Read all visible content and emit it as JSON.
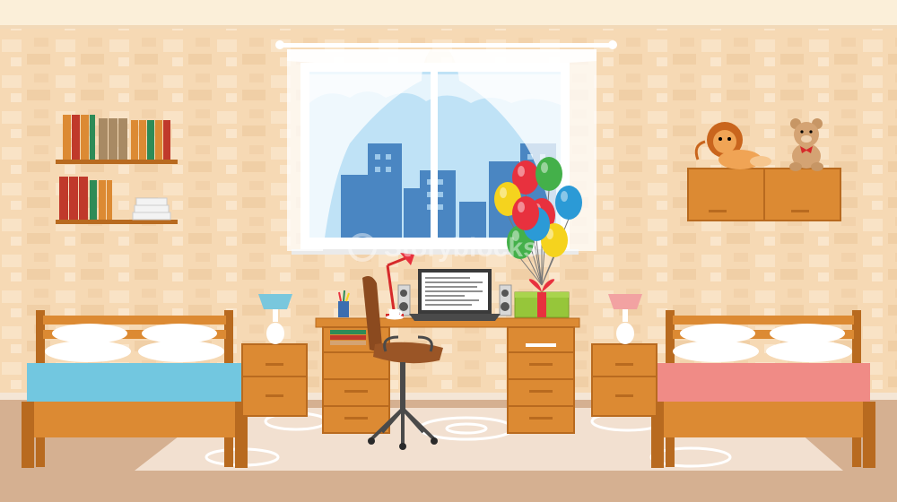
{
  "scene": {
    "title": "",
    "objects": [
      "wallpaper",
      "ceiling-molding",
      "window",
      "curtains",
      "cityscape",
      "bookshelf-upper",
      "bookshelf-lower",
      "wall-cabinet",
      "toy-lion",
      "teddy-bear",
      "bed-left-blue",
      "bed-right-pink",
      "nightstand-left",
      "nightstand-right",
      "lamp-blue",
      "lamp-pink",
      "desk",
      "desk-lamp",
      "laptop",
      "speakers",
      "pen-cup",
      "coffee-cup",
      "office-chair",
      "gift-box",
      "balloons",
      "rug"
    ]
  },
  "watermark": {
    "text": "Storyblocks"
  },
  "colors": {
    "wall": "#f6d9b4",
    "floor": "#d5b091",
    "wood": "#dc8a33",
    "wood_dark": "#b86a1f",
    "sky": "#bfe2f6",
    "blanket_blue": "#72c7e0",
    "blanket_pink": "#f08b86",
    "lamp_blue": "#79c7dd",
    "lamp_pink": "#f2a2a2",
    "gift": "#96c63a",
    "ribbon": "#e8313e"
  },
  "balloons": [
    "#e8313e",
    "#44b04a",
    "#f5d31e",
    "#2b9ad6",
    "#e8313e",
    "#44b04a",
    "#f5d31e",
    "#2b9ad6",
    "#e8313e"
  ]
}
